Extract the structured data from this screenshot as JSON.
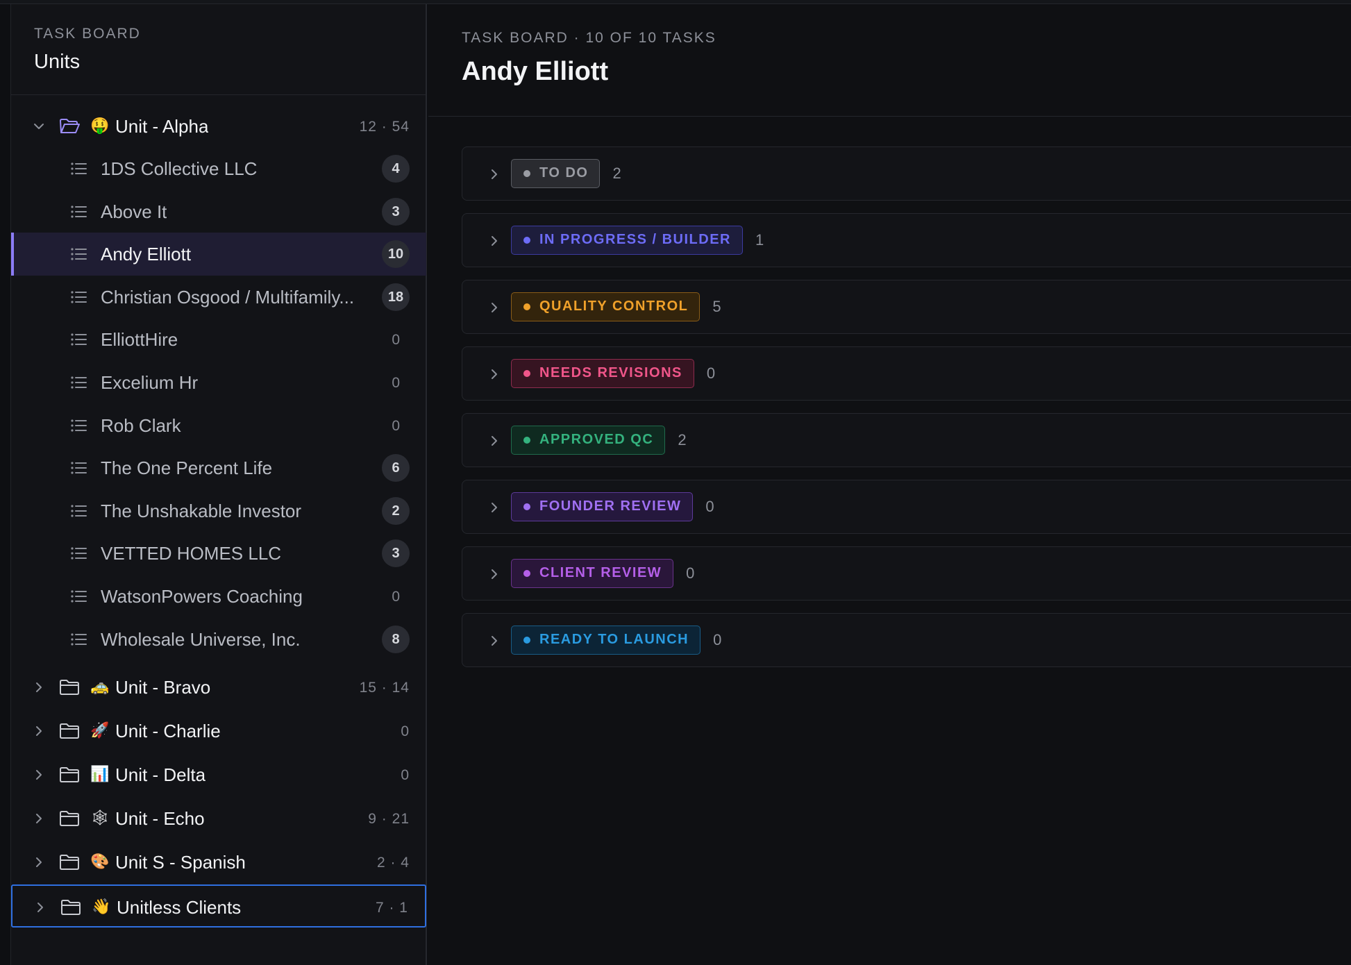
{
  "sidebar": {
    "eyebrow": "TASK BOARD",
    "title": "Units",
    "units": [
      {
        "emoji": "🤑",
        "label": "Unit - Alpha",
        "meta": "12 · 54",
        "expanded": true
      },
      {
        "emoji": "🚕",
        "label": "Unit - Bravo",
        "meta": "15 · 14"
      },
      {
        "emoji": "🚀",
        "label": "Unit - Charlie",
        "meta": "0"
      },
      {
        "emoji": "📊",
        "label": "Unit - Delta",
        "meta": "0"
      },
      {
        "emoji": "🕸",
        "label": "Unit - Echo",
        "meta": "9 · 21"
      },
      {
        "emoji": "🎨",
        "label": "Unit S - Spanish",
        "meta": "2 · 4"
      },
      {
        "emoji": "👋",
        "label": "Unitless Clients",
        "meta": "7 · 1",
        "focused": true
      }
    ],
    "alpha_clients": [
      {
        "label": "1DS Collective LLC",
        "count": "4"
      },
      {
        "label": "Above It",
        "count": "3"
      },
      {
        "label": "Andy Elliott",
        "count": "10",
        "active": true
      },
      {
        "label": "Christian Osgood / Multifamily...",
        "count": "18"
      },
      {
        "label": "ElliottHire",
        "count": "0"
      },
      {
        "label": "Excelium Hr",
        "count": "0"
      },
      {
        "label": "Rob Clark",
        "count": "0"
      },
      {
        "label": "The One Percent Life",
        "count": "6"
      },
      {
        "label": "The Unshakable Investor",
        "count": "2"
      },
      {
        "label": "VETTED HOMES LLC",
        "count": "3"
      },
      {
        "label": "WatsonPowers Coaching",
        "count": "0"
      },
      {
        "label": "Wholesale Universe, Inc.",
        "count": "8"
      }
    ]
  },
  "main": {
    "breadcrumb": "TASK BOARD · 10 OF 10 TASKS",
    "title": "Andy Elliott",
    "groups": [
      {
        "label": "TO DO",
        "count": "2",
        "color": "#9a9ca3",
        "bg": "#2a2b30",
        "border": "#5a5c63"
      },
      {
        "label": "IN PROGRESS / BUILDER",
        "count": "1",
        "color": "#6d6cf7",
        "bg": "#1d1d3c",
        "border": "#3c3ba0"
      },
      {
        "label": "QUALITY CONTROL",
        "count": "5",
        "color": "#f0a12a",
        "bg": "#33240c",
        "border": "#8a5d18"
      },
      {
        "label": "NEEDS REVISIONS",
        "count": "0",
        "color": "#f0568a",
        "bg": "#361421",
        "border": "#8e2c4e"
      },
      {
        "label": "APPROVED QC",
        "count": "2",
        "color": "#34b27e",
        "bg": "#0f2a20",
        "border": "#1f6b4c"
      },
      {
        "label": "FOUNDER REVIEW",
        "count": "0",
        "color": "#a070f2",
        "bg": "#25183d",
        "border": "#5d3a9a"
      },
      {
        "label": "CLIENT REVIEW",
        "count": "0",
        "color": "#b45fe8",
        "bg": "#2a163a",
        "border": "#6a338c"
      },
      {
        "label": "READY TO LAUNCH",
        "count": "0",
        "color": "#2a9be0",
        "bg": "#0c2436",
        "border": "#195d87"
      }
    ]
  }
}
